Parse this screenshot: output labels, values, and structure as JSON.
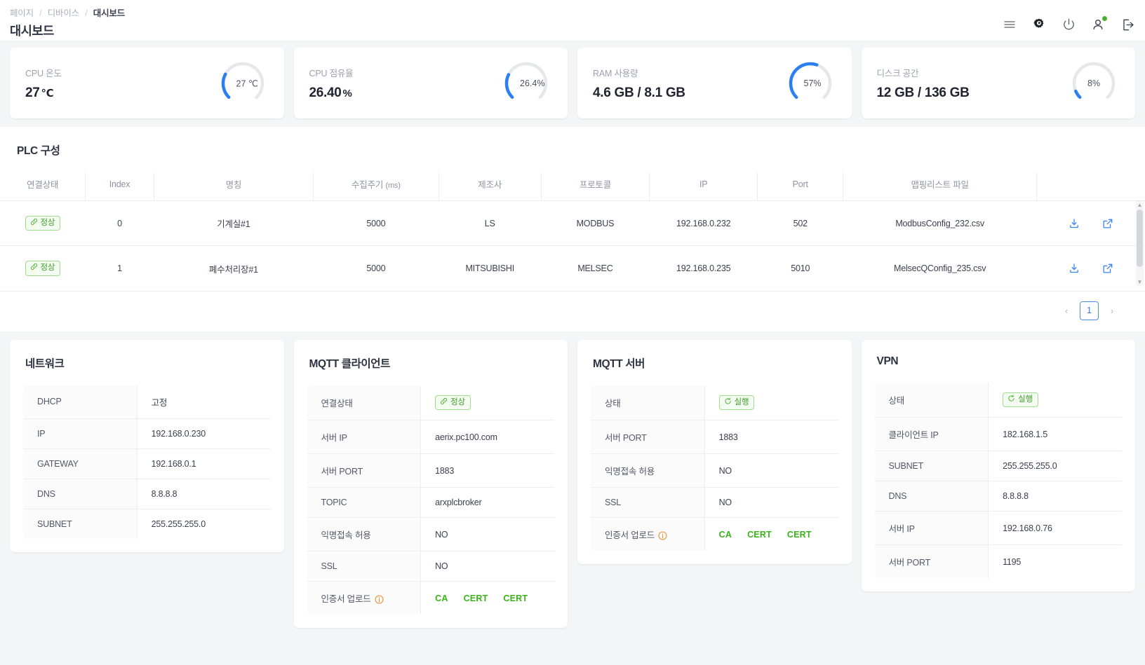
{
  "header": {
    "breadcrumb": [
      "페이지",
      "디바이스",
      "대시보드"
    ],
    "title": "대시보드",
    "icons": [
      "menu-icon",
      "settings-gear-icon",
      "power-icon",
      "user-account-icon",
      "logout-icon"
    ]
  },
  "kpis": [
    {
      "label": "CPU 온도",
      "value": "27",
      "unit": "℃",
      "gauge_caption": "27 ℃",
      "percent": 27
    },
    {
      "label": "CPU 점유율",
      "value": "26.40",
      "unit": "%",
      "gauge_caption": "26.4%",
      "percent": 26.4
    },
    {
      "label": "RAM 사용량",
      "value": "4.6 GB / 8.1 GB",
      "unit": "",
      "gauge_caption": "57%",
      "percent": 57
    },
    {
      "label": "디스크 공간",
      "value": "12 GB / 136 GB",
      "unit": "",
      "gauge_caption": "8%",
      "percent": 8
    }
  ],
  "plc": {
    "title": "PLC 구성",
    "columns": [
      "연결상태",
      "Index",
      "명칭",
      "수집주기 (ms)",
      "제조사",
      "프로토콜",
      "IP",
      "Port",
      "맵핑리스트 파일",
      ""
    ],
    "rows": [
      {
        "status": "정상",
        "index": "0",
        "name": "기계실#1",
        "cycle": "5000",
        "maker": "LS",
        "protocol": "MODBUS",
        "ip": "192.168.0.232",
        "port": "502",
        "file": "ModbusConfig_232.csv"
      },
      {
        "status": "정상",
        "index": "1",
        "name": "폐수처리장#1",
        "cycle": "5000",
        "maker": "MITSUBISHI",
        "protocol": "MELSEC",
        "ip": "192.168.0.235",
        "port": "5010",
        "file": "MelsecQConfig_235.csv"
      }
    ],
    "pagination": {
      "prev": "‹",
      "current": "1",
      "next": "›"
    }
  },
  "cards": [
    {
      "title": "네트워크",
      "rows": [
        {
          "key": "DHCP",
          "value": "고정"
        },
        {
          "key": "IP",
          "value": "192.168.0.230"
        },
        {
          "key": "GATEWAY",
          "value": "192.168.0.1"
        },
        {
          "key": "DNS",
          "value": "8.8.8.8"
        },
        {
          "key": "SUBNET",
          "value": "255.255.255.0"
        }
      ]
    },
    {
      "title": "MQTT 클라이언트",
      "rows": [
        {
          "key": "연결상태",
          "badge": "정상",
          "badge_type": "ok"
        },
        {
          "key": "서버 IP",
          "value": "aerix.pc100.com"
        },
        {
          "key": "서버 PORT",
          "value": "1883"
        },
        {
          "key": "TOPIC",
          "value": "arxplcbroker"
        },
        {
          "key": "익명접속 허용",
          "value": "NO"
        },
        {
          "key": "SSL",
          "value": "NO"
        },
        {
          "key": "인증서 업로드",
          "info": true,
          "certs": [
            "CA",
            "CERT",
            "CERT"
          ]
        }
      ]
    },
    {
      "title": "MQTT 서버",
      "rows": [
        {
          "key": "상태",
          "badge": "실행",
          "badge_type": "run"
        },
        {
          "key": "서버 PORT",
          "value": "1883"
        },
        {
          "key": "익명접속 허용",
          "value": "NO"
        },
        {
          "key": "SSL",
          "value": "NO"
        },
        {
          "key": "인증서 업로드",
          "info": true,
          "certs": [
            "CA",
            "CERT",
            "CERT"
          ]
        }
      ]
    },
    {
      "title": "VPN",
      "rows": [
        {
          "key": "상태",
          "badge": "실행",
          "badge_type": "run"
        },
        {
          "key": "클라이언트 IP",
          "value": "182.168.1.5"
        },
        {
          "key": "SUBNET",
          "value": "255.255.255.0"
        },
        {
          "key": "DNS",
          "value": "8.8.8.8"
        },
        {
          "key": "서버 IP",
          "value": "192.168.0.76"
        },
        {
          "key": "서버 PORT",
          "value": "1195"
        }
      ]
    }
  ],
  "colors": {
    "accent": "#2f80ed",
    "gauge_track": "#e6e7ea",
    "gauge_fill": "#2b7ff0",
    "ok_green": "#3f9c28",
    "cert_green": "#3ab318",
    "info_orange": "#ef8a28"
  }
}
